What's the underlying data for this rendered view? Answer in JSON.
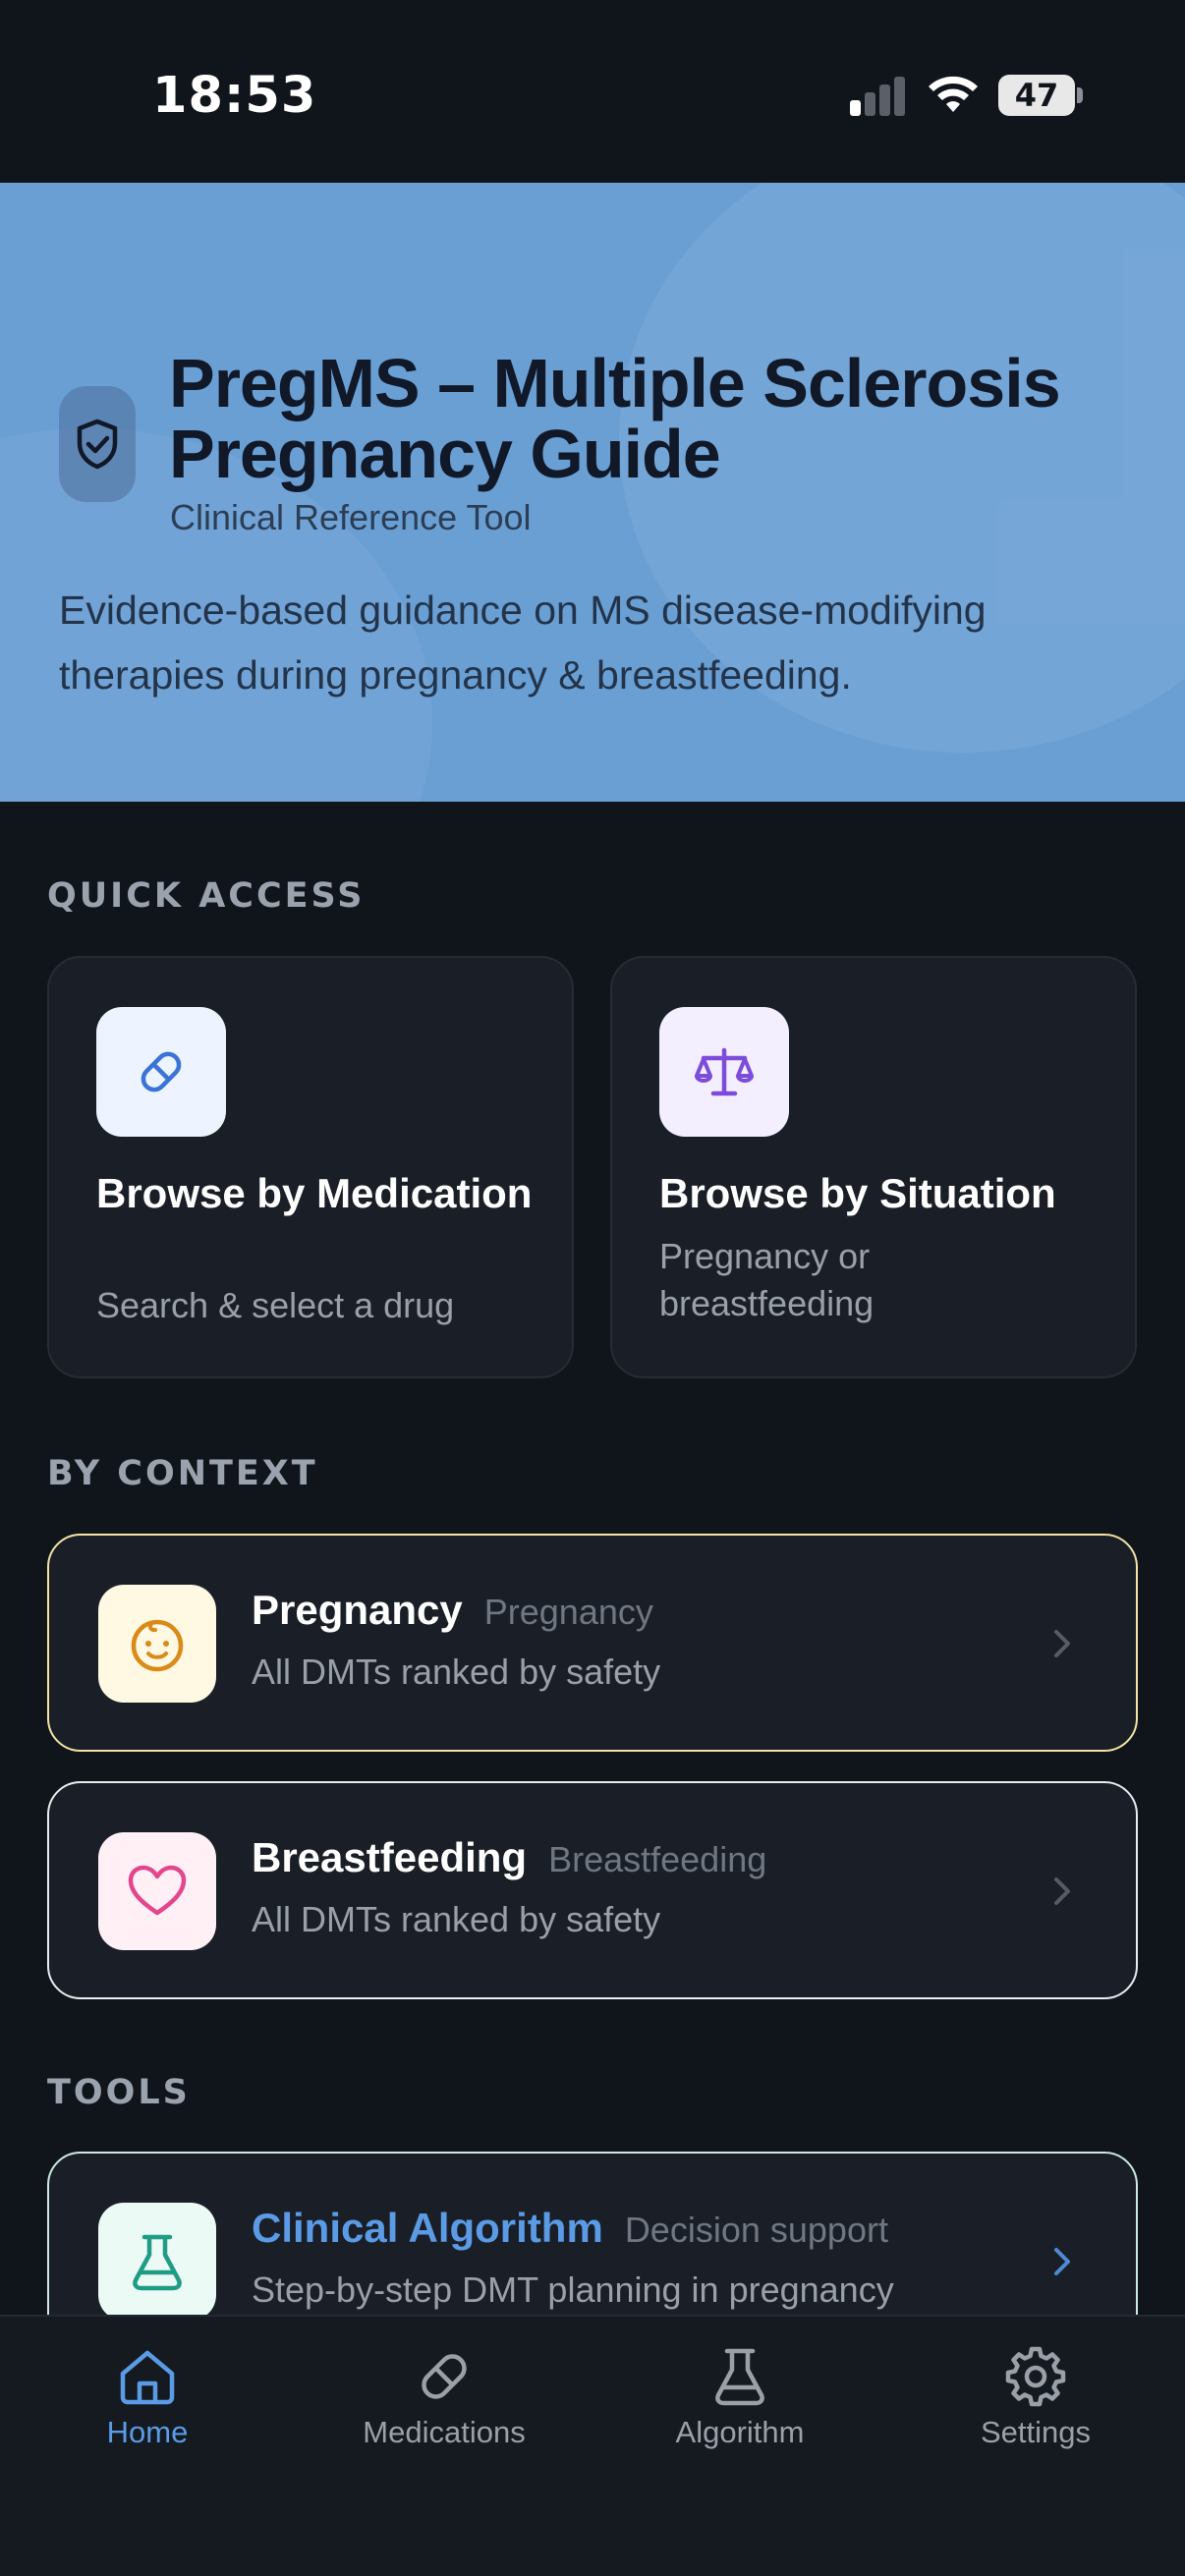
{
  "status_bar": {
    "time": "18:53",
    "battery": "47"
  },
  "hero": {
    "title": "PregMS – Multiple Sclerosis Pregnancy Guide",
    "subtitle": "Clinical Reference Tool",
    "description": "Evidence-based guidance on MS disease-modifying therapies during pregnancy & breastfeeding.",
    "icon": "shield-check-icon"
  },
  "quick_access": {
    "label": "QUICK ACCESS",
    "cards": [
      {
        "title": "Browse by Medication",
        "subtitle": "Search & select a drug",
        "icon": "pill-icon",
        "icon_color": "#3b74d9"
      },
      {
        "title": "Browse by Situation",
        "subtitle": "Pregnancy or breastfeeding",
        "icon": "scale-icon",
        "icon_color": "#7c4dda"
      }
    ]
  },
  "by_context": {
    "label": "BY CONTEXT",
    "items": [
      {
        "title": "Pregnancy",
        "tag": "Pregnancy",
        "subtitle": "All DMTs ranked by safety",
        "icon": "baby-face-icon",
        "accent": "#f3e3a6"
      },
      {
        "title": "Breastfeeding",
        "tag": "Breastfeeding",
        "subtitle": "All DMTs ranked by safety",
        "icon": "heart-icon",
        "accent": "#ffffff"
      }
    ]
  },
  "tools": {
    "label": "TOOLS",
    "items": [
      {
        "title": "Clinical Algorithm",
        "tag": "Decision support",
        "subtitle": "Step-by-step DMT planning in pregnancy",
        "icon": "flask-icon",
        "accent": "#cde9e2"
      }
    ]
  },
  "bottom_nav": {
    "items": [
      {
        "label": "Home",
        "icon": "home-icon",
        "active": true
      },
      {
        "label": "Medications",
        "icon": "pill-icon",
        "active": false
      },
      {
        "label": "Algorithm",
        "icon": "flask-icon",
        "active": false
      },
      {
        "label": "Settings",
        "icon": "gear-icon",
        "active": false
      }
    ]
  },
  "colors": {
    "accent": "#5b9be6",
    "hero_bg": "#6a9fd4",
    "background": "#10151b",
    "card_bg": "#1a1f27"
  }
}
